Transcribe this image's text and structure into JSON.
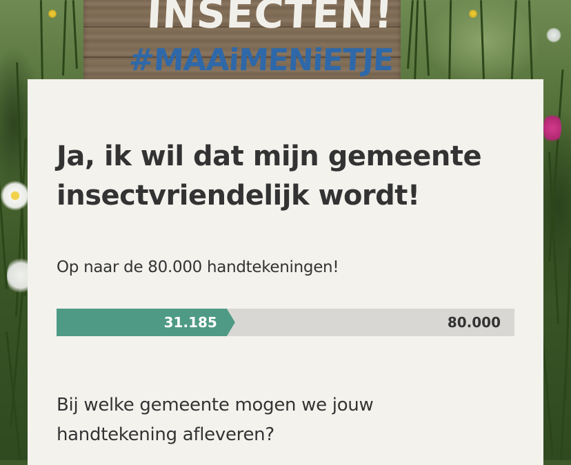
{
  "sign": {
    "line1": "INSECTEN!",
    "line2": "#MAAiMENiETJE"
  },
  "petition": {
    "title": "Ja, ik wil dat mijn gemeente insectvriendelijk wordt!",
    "subtitle": "Op naar de 80.000 handtekeningen!",
    "progress": {
      "current_label": "31.185",
      "goal_label": "80.000",
      "current": 31185,
      "goal": 80000
    },
    "question": "Bij welke gemeente mogen we jouw handtekening afleveren?"
  },
  "colors": {
    "card_background": "#f3f2ed",
    "progress_fill": "#4f9a84",
    "progress_track": "#d8d7d4",
    "text": "#333333",
    "sign_blue": "#2f68a8"
  }
}
